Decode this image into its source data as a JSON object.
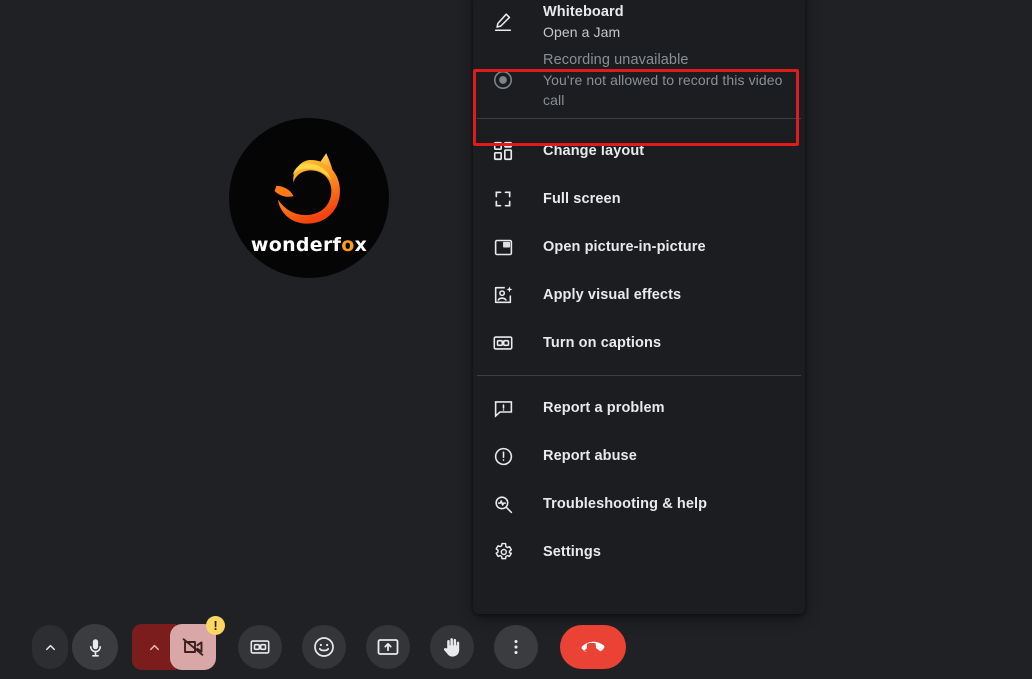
{
  "app": {
    "background_color": "#202124",
    "panel_color": "#1b1d21",
    "accent_color": "#ea4335",
    "highlight_color": "#e01b1b"
  },
  "stage": {
    "avatar": {
      "name": "wonderfox",
      "logo_word_part1": "wonderf",
      "logo_word_o": "o",
      "logo_word_part2": "x",
      "icon": "fox-flame-logo"
    }
  },
  "menu": {
    "groups": [
      {
        "items": [
          {
            "icon": "whiteboard-pencil-icon",
            "title": "Whiteboard",
            "subtitle": "Open a Jam",
            "disabled": false
          },
          {
            "icon": "record-circle-icon",
            "title": "Recording unavailable",
            "subtitle": "You're not allowed to record this video call",
            "disabled": true,
            "highlighted": true
          }
        ]
      },
      {
        "items": [
          {
            "icon": "change-layout-icon",
            "title": "Change layout",
            "disabled": false
          },
          {
            "icon": "full-screen-icon",
            "title": "Full screen",
            "disabled": false
          },
          {
            "icon": "picture-in-picture-icon",
            "title": "Open picture-in-picture",
            "disabled": false
          },
          {
            "icon": "visual-effects-icon",
            "title": "Apply visual effects",
            "disabled": false
          },
          {
            "icon": "captions-cc-icon",
            "title": "Turn on captions",
            "disabled": false
          }
        ]
      },
      {
        "items": [
          {
            "icon": "report-problem-icon",
            "title": "Report a problem",
            "disabled": false
          },
          {
            "icon": "report-abuse-icon",
            "title": "Report abuse",
            "disabled": false
          },
          {
            "icon": "troubleshooting-icon",
            "title": "Troubleshooting & help",
            "disabled": false
          },
          {
            "icon": "settings-gear-icon",
            "title": "Settings",
            "disabled": false
          }
        ]
      }
    ]
  },
  "controls": {
    "mic_caret_label": "",
    "mic_label": "",
    "camera_caret_label": "",
    "camera_label": "",
    "camera_warning_badge": "!",
    "captions_label": "",
    "reactions_label": "",
    "present_label": "",
    "raise_hand_label": "",
    "more_options_label": "",
    "end_call_label": "",
    "items": [
      {
        "name": "mic-options-caret",
        "icon": "chevron-up-icon"
      },
      {
        "name": "microphone-button",
        "icon": "microphone-icon"
      },
      {
        "name": "camera-options-caret",
        "icon": "chevron-up-icon"
      },
      {
        "name": "camera-button",
        "icon": "camera-off-icon",
        "badge": "!"
      },
      {
        "name": "captions-button",
        "icon": "captions-cc-icon"
      },
      {
        "name": "reactions-button",
        "icon": "smiley-icon"
      },
      {
        "name": "present-now-button",
        "icon": "present-screen-icon"
      },
      {
        "name": "raise-hand-button",
        "icon": "raise-hand-icon"
      },
      {
        "name": "more-options-button",
        "icon": "three-dots-vertical-icon"
      },
      {
        "name": "end-call-button",
        "icon": "phone-hangup-icon"
      }
    ]
  }
}
